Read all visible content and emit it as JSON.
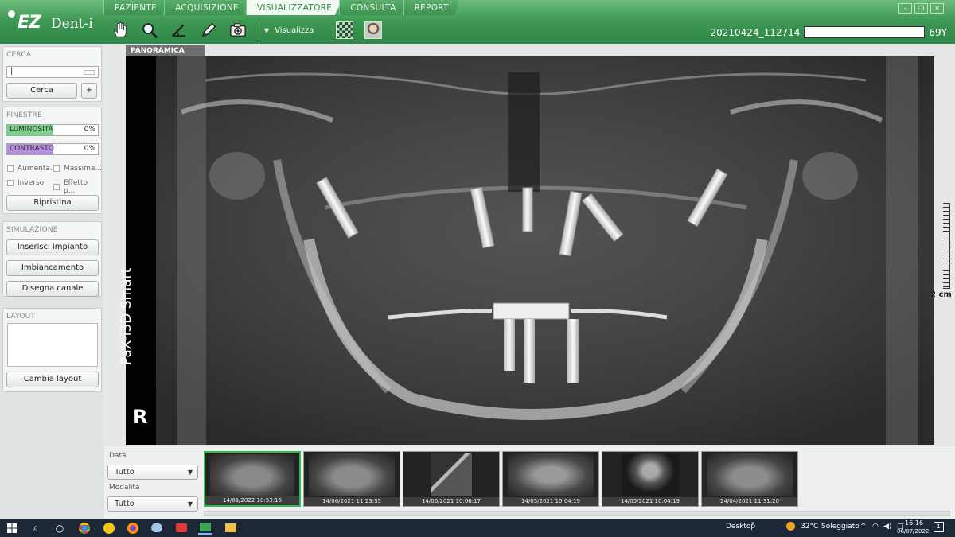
{
  "app": {
    "logo_ez": "EZ",
    "logo_dent": "Dent-i"
  },
  "tabs": [
    {
      "label": "PAZIENTE"
    },
    {
      "label": "ACQUISIZIONE"
    },
    {
      "label": "VISUALIZZATORE"
    },
    {
      "label": "CONSULTA"
    },
    {
      "label": "REPORT"
    }
  ],
  "toolbar": {
    "menu_label": "Visualizza",
    "tools": [
      "hand-icon",
      "magnifier-icon",
      "angle-icon",
      "pencil-icon",
      "camera-icon",
      "layout-grid-icon",
      "face-icon"
    ]
  },
  "patient": {
    "id": "20210424_112714",
    "age": "69Y"
  },
  "sidebar": {
    "cerca": {
      "title": "CERCA",
      "search_value": "|",
      "button": "Cerca",
      "plus": "+"
    },
    "finestre": {
      "title": "FINESTRE",
      "luminosita": {
        "label": "LUMINOSITÀ",
        "value": "0%",
        "color": "#7bd08a"
      },
      "contrasto": {
        "label": "CONTRASTO",
        "value": "0%",
        "color": "#b68ee0"
      },
      "checks": [
        "Aumenta...",
        "Massima...",
        "Inverso",
        "Effetto p..."
      ],
      "reset": "Ripristina"
    },
    "simulazione": {
      "title": "SIMULAZIONE",
      "buttons": [
        "Inserisci impianto",
        "Imbiancamento",
        "Disegna canale"
      ]
    },
    "layout": {
      "title": "LAYOUT",
      "button": "Cambia layout"
    }
  },
  "viewer": {
    "tag": "PANORAMICA",
    "device": "PaX-i3D Smart",
    "side_marker": "R",
    "scale_label": "2 cm"
  },
  "filters": {
    "data_label": "Data",
    "data_value": "Tutto",
    "modalita_label": "Modalità",
    "modalita_value": "Tutto"
  },
  "thumbnails": [
    {
      "caption": "14/01/2022 10:53:16",
      "kind": "pano-implant"
    },
    {
      "caption": "14/06/2021 11:23:35",
      "kind": "pano"
    },
    {
      "caption": "14/06/2021 10:06:17",
      "kind": "ct"
    },
    {
      "caption": "14/05/2021 10:04:19",
      "kind": "pano-bar"
    },
    {
      "caption": "14/05/2021 10:04:19",
      "kind": "ct-axial"
    },
    {
      "caption": "24/04/2021 11:31:20",
      "kind": "pano-bar"
    }
  ],
  "taskbar": {
    "desktop": "Desktop",
    "temp": "32°C",
    "weather": "Soleggiato",
    "time": "16:16",
    "date": "06/07/2022",
    "notifications": "1"
  },
  "colors": {
    "accent": "#3f9a55",
    "selected_thumb": "#2fbf4a"
  }
}
